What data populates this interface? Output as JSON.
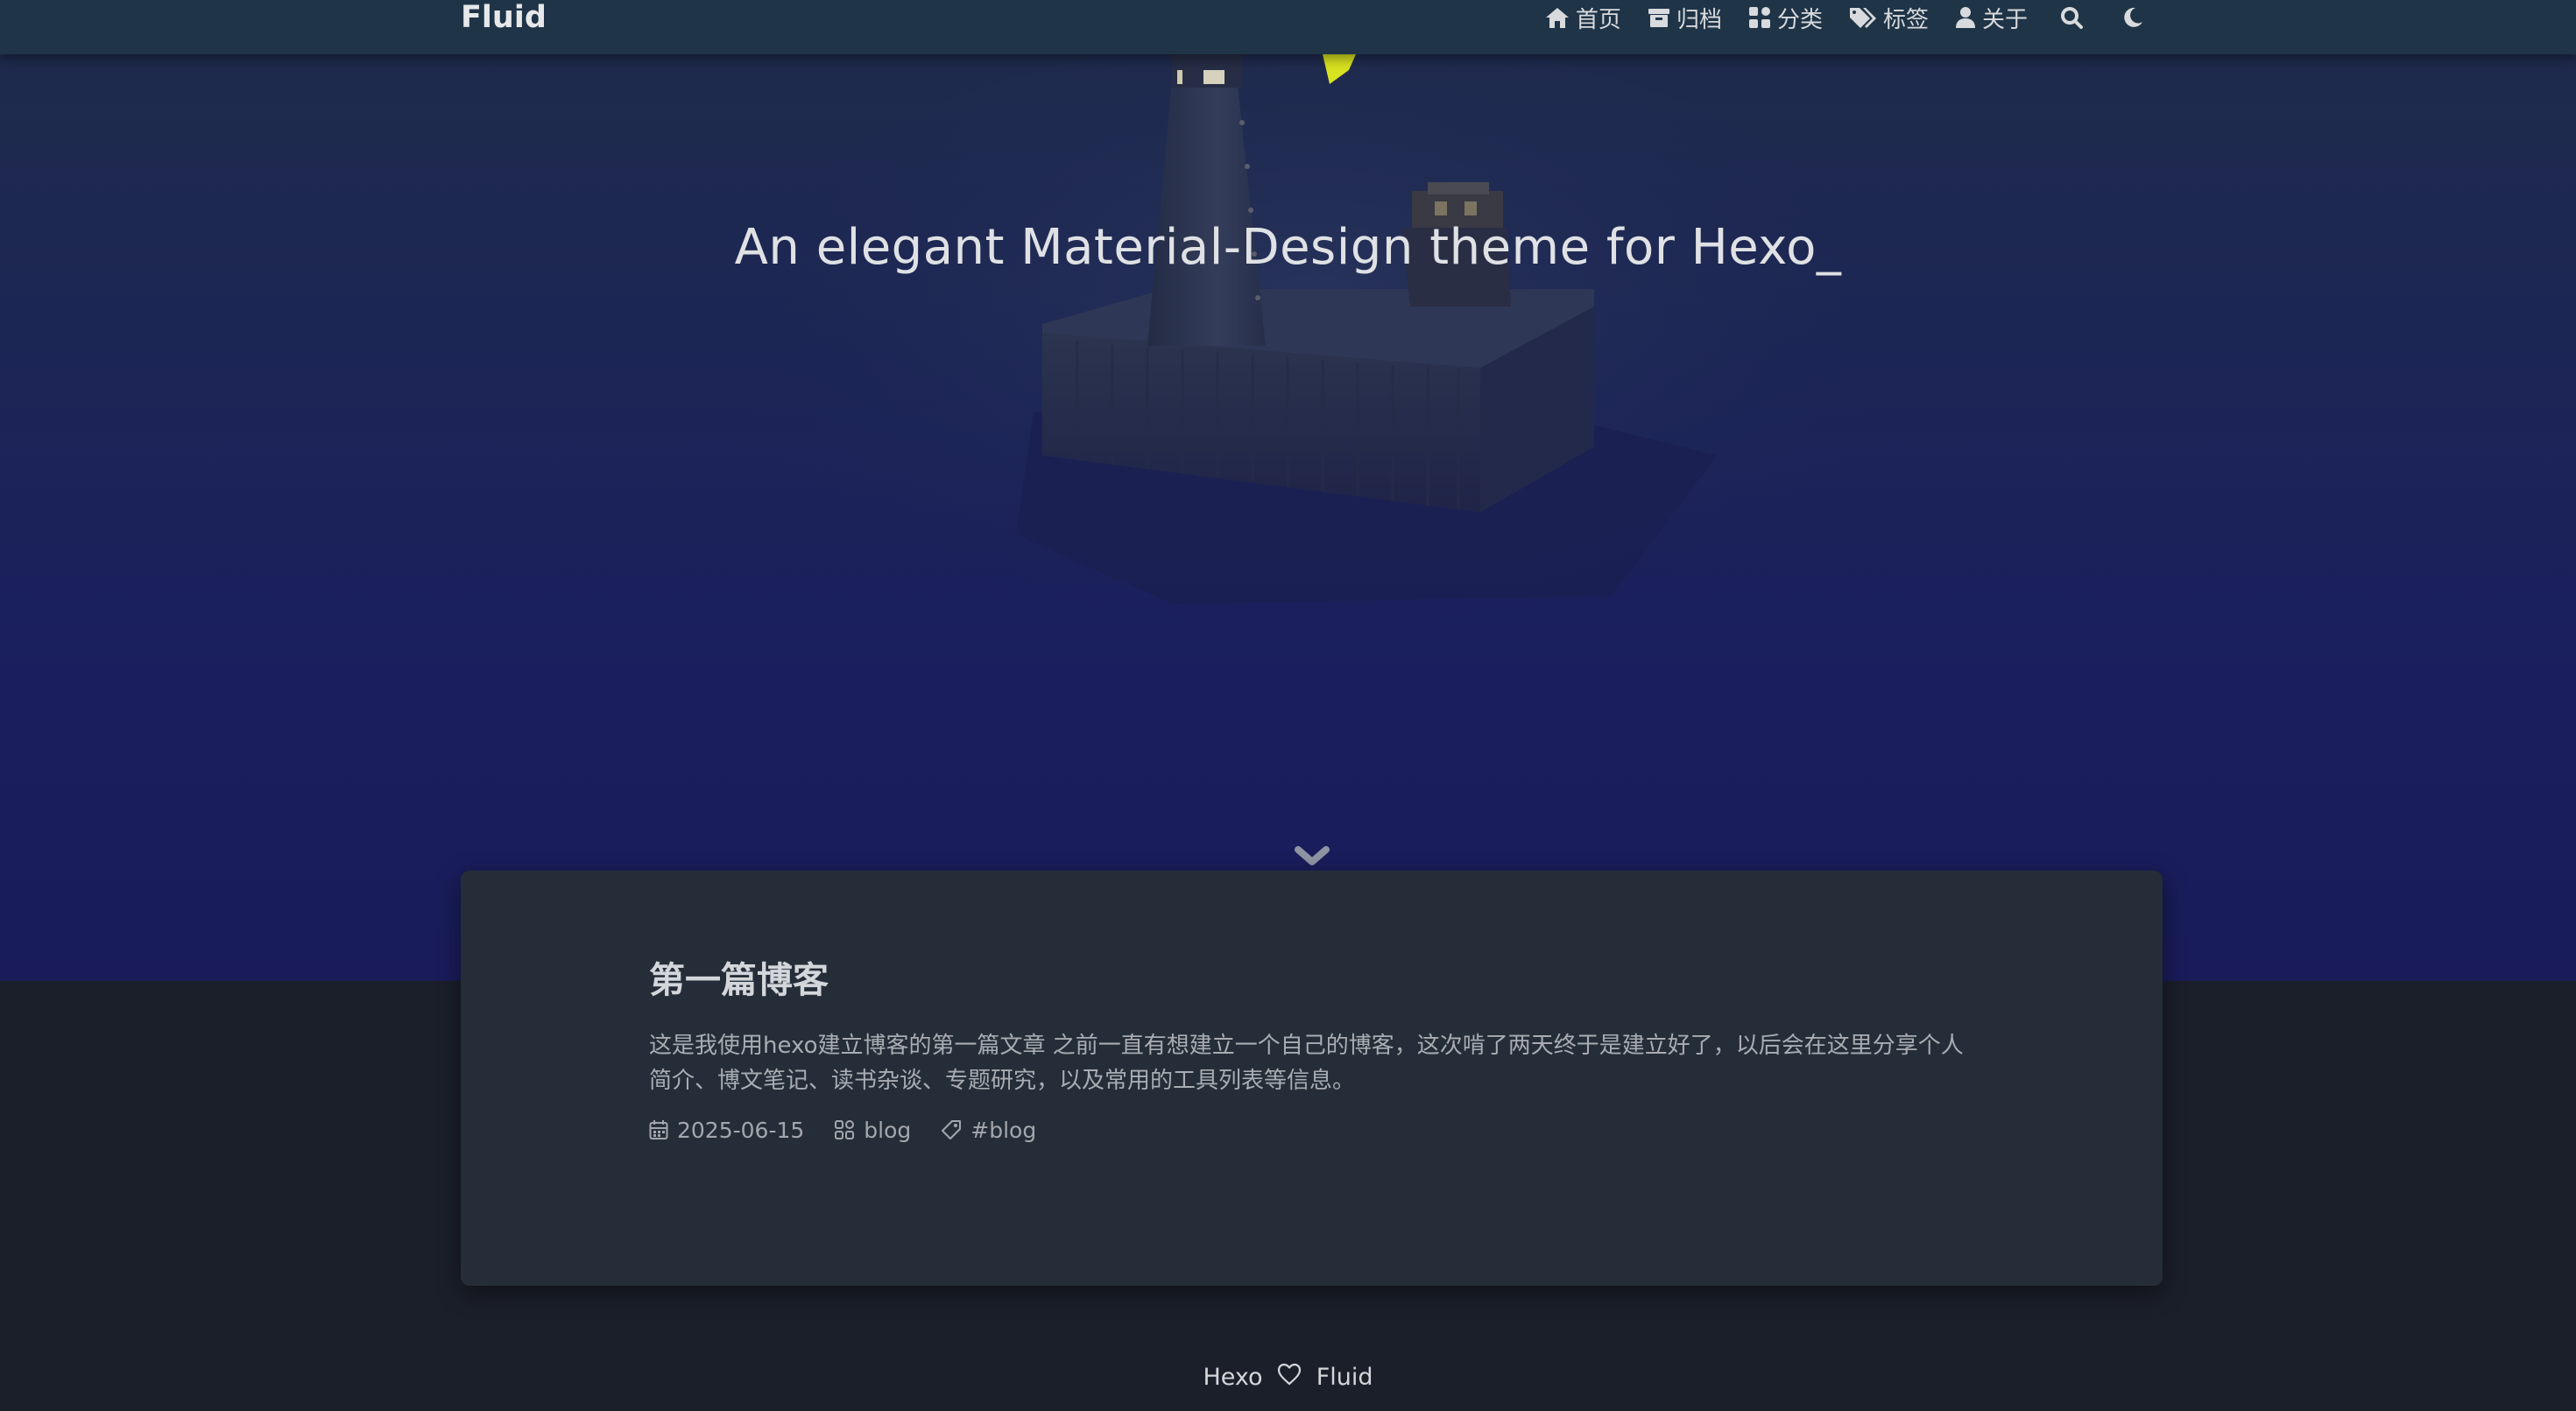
{
  "navbar": {
    "brand": "Fluid",
    "items": [
      {
        "label": "首页",
        "icon": "home-icon"
      },
      {
        "label": "归档",
        "icon": "archive-icon"
      },
      {
        "label": "分类",
        "icon": "category-icon"
      },
      {
        "label": "标签",
        "icon": "tags-icon"
      },
      {
        "label": "关于",
        "icon": "user-icon"
      }
    ],
    "search_icon": "search-icon",
    "theme_toggle_icon": "moon-icon"
  },
  "banner": {
    "slogan": "An elegant Material-Design theme for Hexo_",
    "scroll_icon": "chevron-down-icon"
  },
  "posts": [
    {
      "title": "第一篇博客",
      "excerpt": "这是我使用hexo建立博客的第一篇文章 之前一直有想建立一个自己的博客，这次啃了两天终于是建立好了，以后会在这里分享个人简介、博文笔记、读书杂谈、专题研究，以及常用的工具列表等信息。",
      "date": "2025-06-15",
      "category": "blog",
      "tag": "#blog"
    }
  ],
  "footer": {
    "left": "Hexo",
    "right": "Fluid",
    "heart_icon": "heart-icon"
  },
  "colors": {
    "navbar_bg": "#1f3447",
    "banner_bg": "#1c2655",
    "page_bg": "#1b1f2a",
    "card_bg": "#252d38",
    "lighthouse_light": "#d8e21a"
  }
}
